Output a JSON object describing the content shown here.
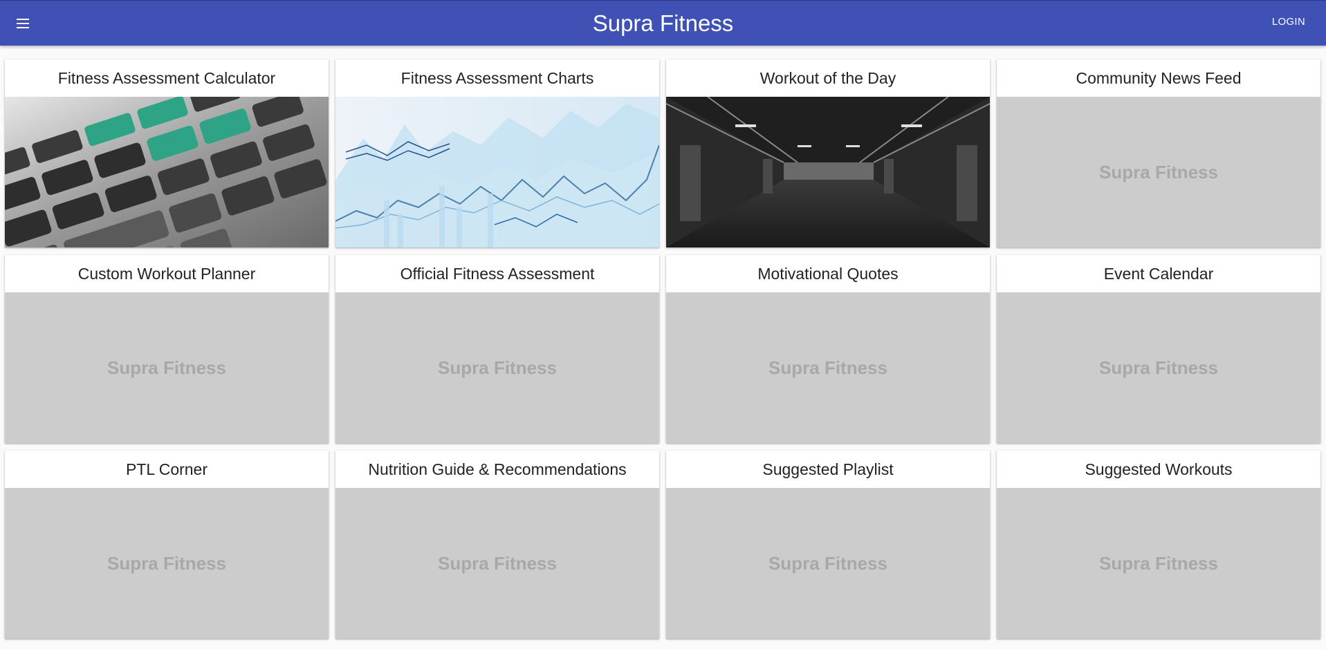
{
  "appbar": {
    "title": "Supra Fitness",
    "login_label": "LOGIN",
    "color": "#3f51b5"
  },
  "cards": [
    {
      "title": "Fitness Assessment Calculator",
      "media": "calculator-image"
    },
    {
      "title": "Fitness Assessment Charts",
      "media": "charts-image"
    },
    {
      "title": "Workout of the Day",
      "media": "gym-image"
    },
    {
      "title": "Community News Feed",
      "placeholder": "Supra Fitness"
    },
    {
      "title": "Custom Workout Planner",
      "placeholder": "Supra Fitness"
    },
    {
      "title": "Official Fitness Assessment",
      "placeholder": "Supra Fitness"
    },
    {
      "title": "Motivational Quotes",
      "placeholder": "Supra Fitness"
    },
    {
      "title": "Event Calendar",
      "placeholder": "Supra Fitness"
    },
    {
      "title": "PTL Corner",
      "placeholder": "Supra Fitness"
    },
    {
      "title": "Nutrition Guide & Recommendations",
      "placeholder": "Supra Fitness"
    },
    {
      "title": "Suggested Playlist",
      "placeholder": "Supra Fitness"
    },
    {
      "title": "Suggested Workouts",
      "placeholder": "Supra Fitness"
    }
  ]
}
